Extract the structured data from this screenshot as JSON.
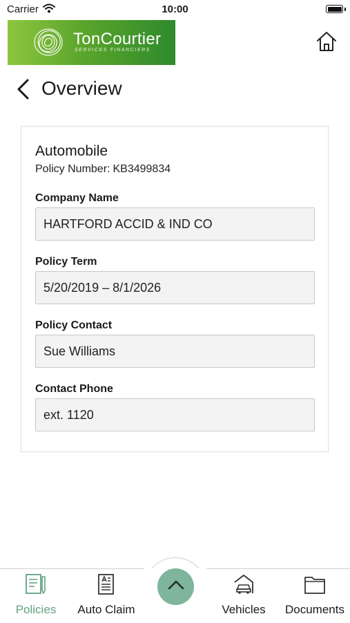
{
  "status_bar": {
    "carrier": "Carrier",
    "time": "10:00"
  },
  "header": {
    "brand_name": "TonCourtier",
    "brand_tagline": "SERVICES FINANCIERS",
    "icons": {
      "home": "home-icon",
      "wifi": "wifi-icon",
      "battery": "battery-icon"
    }
  },
  "page": {
    "title": "Overview",
    "back_icon": "chevron-left-icon"
  },
  "policy": {
    "title": "Automobile",
    "number_label": "Policy Number:",
    "number_value": "KB3499834",
    "fields": [
      {
        "label": "Company Name",
        "value": "HARTFORD ACCID & IND CO"
      },
      {
        "label": "Policy Term",
        "value": "5/20/2019 – 8/1/2026"
      },
      {
        "label": "Policy Contact",
        "value": "Sue Williams"
      },
      {
        "label": "Contact Phone",
        "value": "ext. 1120"
      }
    ]
  },
  "bottom_nav": {
    "items": [
      {
        "label": "Policies",
        "icon": "policy-document-icon",
        "active": true
      },
      {
        "label": "Auto Claim",
        "icon": "claim-form-icon",
        "active": false
      },
      {
        "label": "Vehicles",
        "icon": "car-garage-icon",
        "active": false
      },
      {
        "label": "Documents",
        "icon": "folder-icon",
        "active": false
      }
    ],
    "fab_icon": "chevron-up-icon"
  },
  "colors": {
    "accent": "#5fa27f",
    "fab": "#7fb59c",
    "brand_gradient_start": "#8dc63f",
    "brand_gradient_end": "#2e8a2c",
    "field_background": "#f3f3f3"
  }
}
